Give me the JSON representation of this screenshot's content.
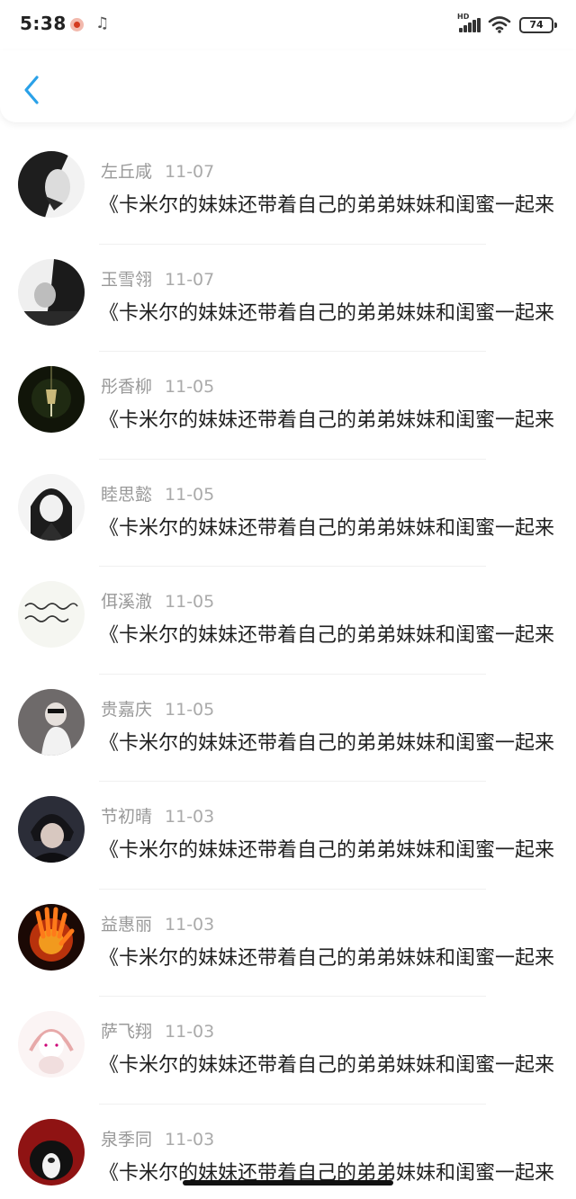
{
  "status_bar": {
    "time": "5:38",
    "battery": "74",
    "network": "HD",
    "icons": [
      "notification-icon",
      "music-icon",
      "signal-icon",
      "wifi-icon",
      "battery-icon"
    ]
  },
  "header": {
    "back_icon": "chevron-left-icon",
    "accent": "#2aa1e8"
  },
  "items": [
    {
      "name": "左丘咸",
      "date": "11-07",
      "title": "《卡米尔的妹妹还带着自己的弟弟妹妹和闺蜜一起来",
      "avatar_color": "#2b2b2b"
    },
    {
      "name": "玉雪翎",
      "date": "11-07",
      "title": "《卡米尔的妹妹还带着自己的弟弟妹妹和闺蜜一起来",
      "avatar_color": "#3a3a3a"
    },
    {
      "name": "彤香柳",
      "date": "11-05",
      "title": "《卡米尔的妹妹还带着自己的弟弟妹妹和闺蜜一起来",
      "avatar_color": "#1a1d12"
    },
    {
      "name": "睦思懿",
      "date": "11-05",
      "title": "《卡米尔的妹妹还带着自己的弟弟妹妹和闺蜜一起来",
      "avatar_color": "#e9e9e9"
    },
    {
      "name": "佴溪澈",
      "date": "11-05",
      "title": "《卡米尔的妹妹还带着自己的弟弟妹妹和闺蜜一起来",
      "avatar_color": "#f4f4ef"
    },
    {
      "name": "贵嘉庆",
      "date": "11-05",
      "title": "《卡米尔的妹妹还带着自己的弟弟妹妹和闺蜜一起来",
      "avatar_color": "#5a5656"
    },
    {
      "name": "节初晴",
      "date": "11-03",
      "title": "《卡米尔的妹妹还带着自己的弟弟妹妹和闺蜜一起来",
      "avatar_color": "#2e2f3b"
    },
    {
      "name": "益惠丽",
      "date": "11-03",
      "title": "《卡米尔的妹妹还带着自己的弟弟妹妹和闺蜜一起来",
      "avatar_color": "#b53a12"
    },
    {
      "name": "萨飞翔",
      "date": "11-03",
      "title": "《卡米尔的妹妹还带着自己的弟弟妹妹和闺蜜一起来",
      "avatar_color": "#f6e3e3"
    },
    {
      "name": "泉季同",
      "date": "11-03",
      "title": "《卡米尔的妹妹还带着自己的弟弟妹妹和闺蜜一起来",
      "avatar_color": "#8a1414"
    }
  ]
}
